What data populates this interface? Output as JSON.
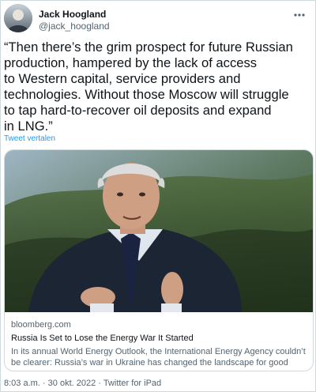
{
  "author": {
    "name": "Jack Hoogland",
    "handle": "@jack_hoogland"
  },
  "tweet": {
    "text": "“Then there’s the grim prospect for future Russian\nproduction, hampered by the lack of access\nto Western capital, service providers and\ntechnologies. Without those Moscow will struggle\nto tap hard-to-recover oil deposits and expand\nin LNG.”",
    "translate_label": "Tweet vertalen"
  },
  "link_card": {
    "domain": "bloomberg.com",
    "title": "Russia Is Set to Lose the Energy War It Started",
    "description": "In its annual World Energy Outlook, the International Energy Agency couldn’t be clearer: Russia’s war in Ukraine has changed the landscape for good"
  },
  "footer": {
    "time": "8:03 a.m.",
    "date": "30 okt. 2022",
    "source": "Twitter for iPad",
    "separator": "·"
  },
  "icons": {
    "more": "more-horizontal-icon"
  },
  "colors": {
    "text": "#0f1419",
    "secondary": "#536471",
    "link": "#1d9bf0",
    "border": "#cfd9de"
  }
}
